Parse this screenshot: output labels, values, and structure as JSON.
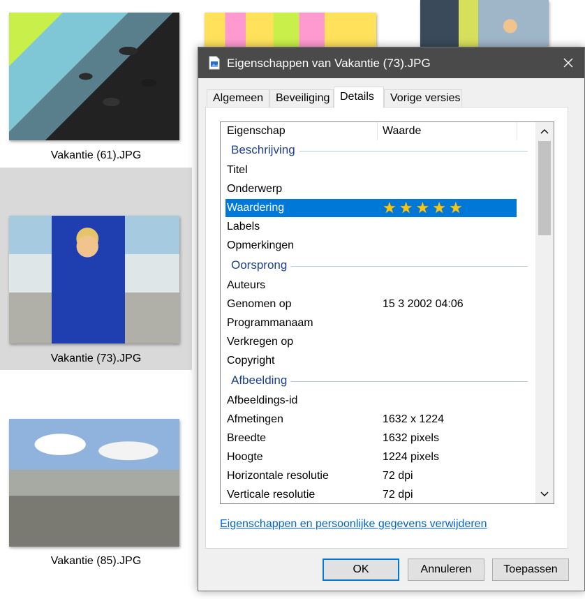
{
  "explorer": {
    "thumbnails": [
      {
        "caption": "Vakantie (61).JPG",
        "selected": false
      },
      {
        "caption": "Vakantie (73).JPG",
        "selected": true
      },
      {
        "caption": "Vakantie (85).JPG",
        "selected": false
      }
    ]
  },
  "dialog": {
    "title": "Eigenschappen van Vakantie (73).JPG",
    "tabs": [
      {
        "label": "Algemeen",
        "active": false
      },
      {
        "label": "Beveiliging",
        "active": false
      },
      {
        "label": "Details",
        "active": true
      },
      {
        "label": "Vorige versies",
        "active": false
      }
    ],
    "columns": {
      "property": "Eigenschap",
      "value": "Waarde"
    },
    "groups": {
      "description": {
        "header": "Beschrijving",
        "rows": [
          {
            "property": "Titel",
            "value": ""
          },
          {
            "property": "Onderwerp",
            "value": ""
          },
          {
            "property": "Waardering",
            "rating": 5,
            "rating_max": 5
          },
          {
            "property": "Labels",
            "value": ""
          },
          {
            "property": "Opmerkingen",
            "value": ""
          }
        ]
      },
      "origin": {
        "header": "Oorsprong",
        "rows": [
          {
            "property": "Auteurs",
            "value": ""
          },
          {
            "property": "Genomen op",
            "value": "15 3 2002 04:06"
          },
          {
            "property": "Programmanaam",
            "value": ""
          },
          {
            "property": "Verkregen op",
            "value": ""
          },
          {
            "property": "Copyright",
            "value": ""
          }
        ]
      },
      "image": {
        "header": "Afbeelding",
        "rows": [
          {
            "property": "Afbeeldings-id",
            "value": ""
          },
          {
            "property": "Afmetingen",
            "value": "1632 x 1224"
          },
          {
            "property": "Breedte",
            "value": "1632 pixels"
          },
          {
            "property": "Hoogte",
            "value": "1224 pixels"
          },
          {
            "property": "Horizontale resolutie",
            "value": "72 dpi"
          },
          {
            "property": "Verticale resolutie",
            "value": "72 dpi"
          }
        ]
      }
    },
    "remove_link": "Eigenschappen en persoonlijke gegevens verwijderen",
    "buttons": {
      "ok": "OK",
      "cancel": "Annuleren",
      "apply": "Toepassen"
    },
    "colors": {
      "selection": "#0078d7",
      "star": "#f5c518",
      "group_header": "#1e3f8f",
      "link": "#0066cc"
    }
  }
}
